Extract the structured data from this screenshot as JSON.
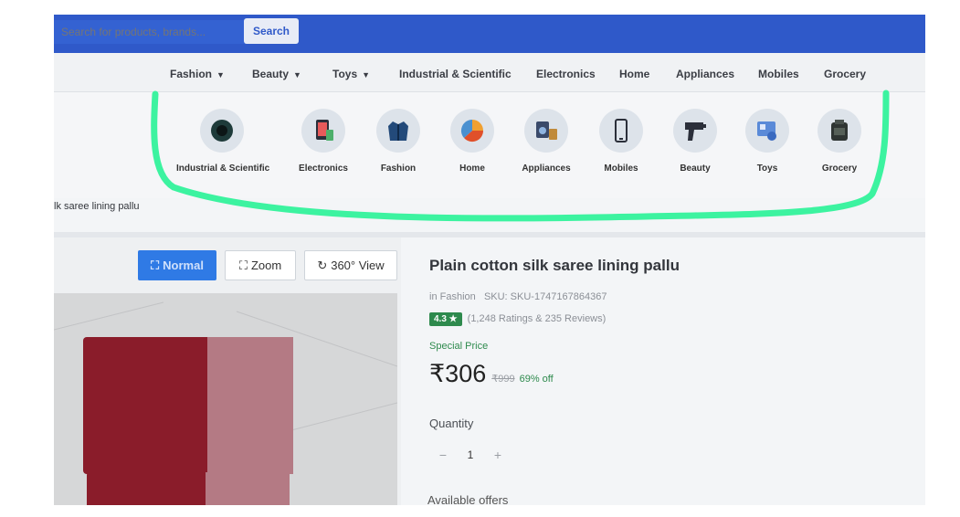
{
  "search": {
    "placeholder": "Search for products, brands...",
    "button": "Search"
  },
  "nav": [
    {
      "label": "Fashion",
      "has_dropdown": true
    },
    {
      "label": "Beauty",
      "has_dropdown": true
    },
    {
      "label": "Toys",
      "has_dropdown": true
    },
    {
      "label": "Industrial & Scientific",
      "has_dropdown": false
    },
    {
      "label": "Electronics",
      "has_dropdown": false
    },
    {
      "label": "Home",
      "has_dropdown": false
    },
    {
      "label": "Appliances",
      "has_dropdown": false
    },
    {
      "label": "Mobiles",
      "has_dropdown": false
    },
    {
      "label": "Grocery",
      "has_dropdown": false
    }
  ],
  "categories": [
    {
      "label": "Industrial & Scientific",
      "icon": "industrial-icon"
    },
    {
      "label": "Electronics",
      "icon": "electronics-icon"
    },
    {
      "label": "Fashion",
      "icon": "jacket-icon"
    },
    {
      "label": "Home",
      "icon": "home-decor-icon"
    },
    {
      "label": "Appliances",
      "icon": "appliances-icon"
    },
    {
      "label": "Mobiles",
      "icon": "mobile-phone-icon"
    },
    {
      "label": "Beauty",
      "icon": "hair-dryer-icon"
    },
    {
      "label": "Toys",
      "icon": "toys-icon"
    },
    {
      "label": "Grocery",
      "icon": "grocery-icon"
    }
  ],
  "breadcrumb": "lk saree lining pallu",
  "view_buttons": {
    "normal": "Normal",
    "zoom": "Zoom",
    "view360": "360° View"
  },
  "product": {
    "title": "Plain cotton silk saree lining pallu",
    "category": "in Fashion",
    "sku": "SKU: SKU-1747167864367",
    "rating": "4.3 ★",
    "ratings_reviews": "(1,248 Ratings & 235 Reviews)",
    "special_label": "Special Price",
    "price": "₹306",
    "mrp": "₹999",
    "discount": "69% off",
    "quantity_label": "Quantity",
    "quantity": "1",
    "qty_minus": "−",
    "qty_plus": "+",
    "offers_label": "Available offers"
  },
  "colors": {
    "header_blue": "#2f59c9",
    "accent_blue": "#2f7ae5",
    "rating_green": "#2e8a4d",
    "annotation_green": "#3cf3a0"
  }
}
